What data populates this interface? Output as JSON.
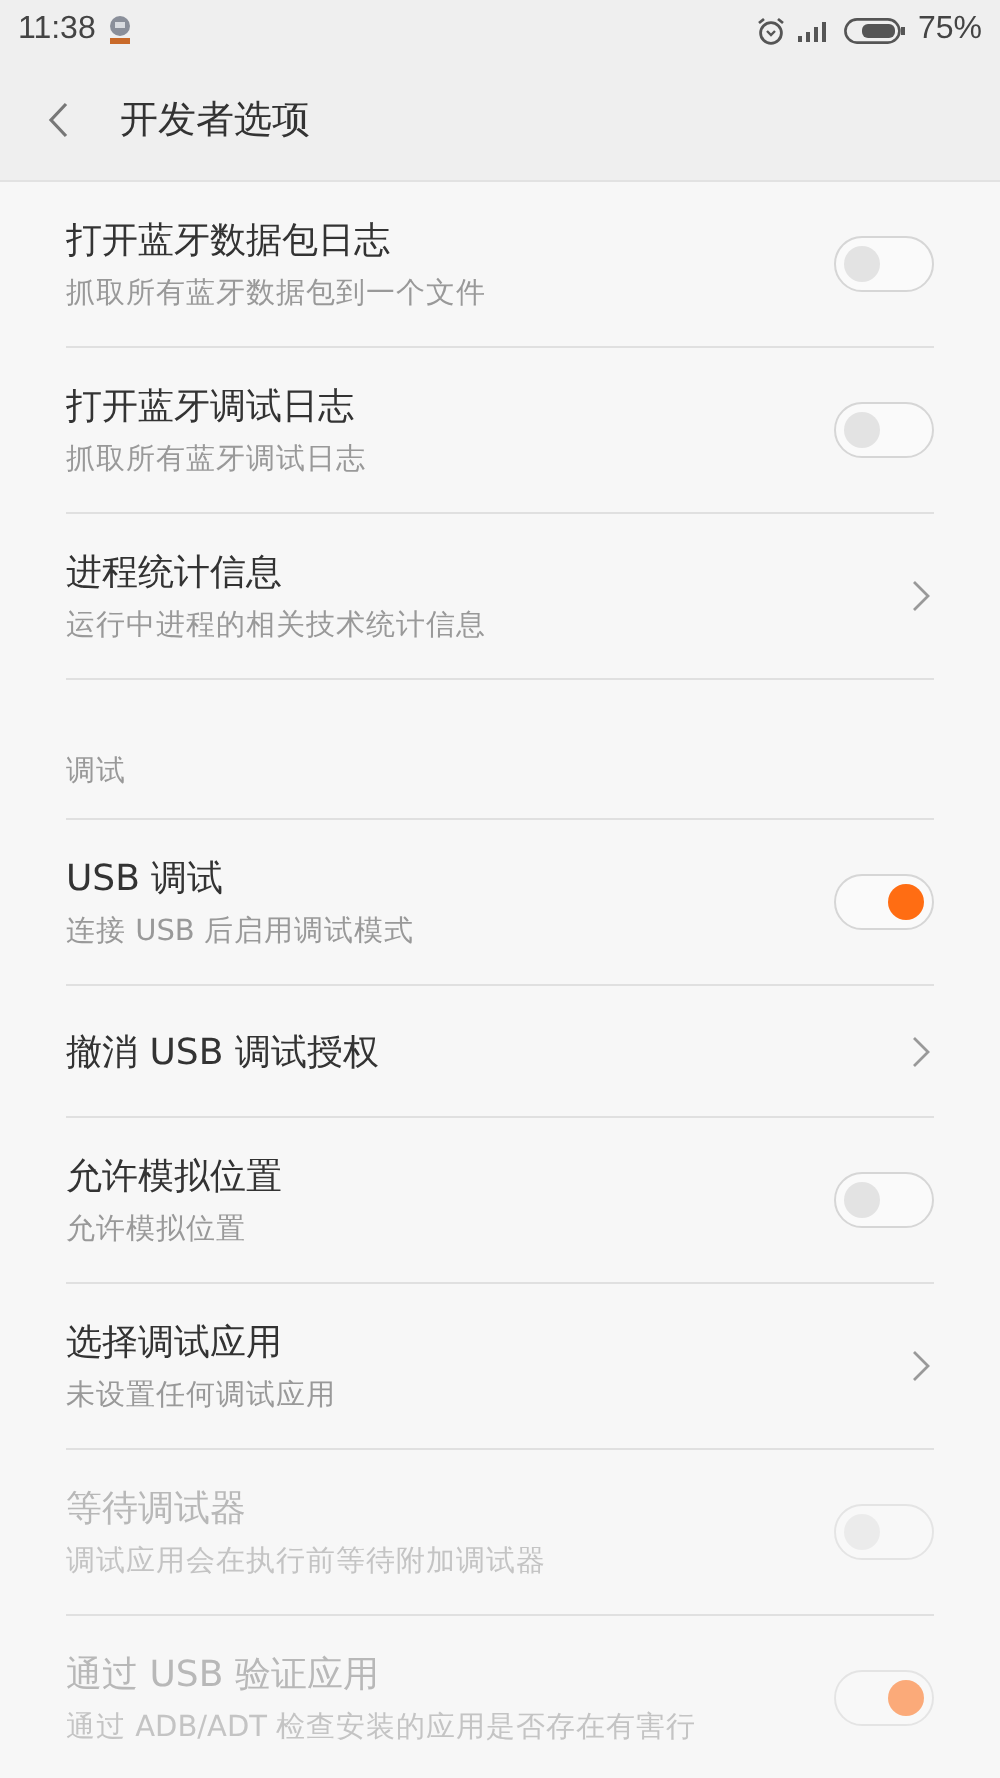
{
  "status_bar": {
    "time": "11:38",
    "battery_percent": "75%"
  },
  "header": {
    "title": "开发者选项"
  },
  "items": [
    {
      "kind": "toggle",
      "title": "打开蓝牙数据包日志",
      "subtitle": "抓取所有蓝牙数据包到一个文件",
      "on": false,
      "disabled": false
    },
    {
      "kind": "toggle",
      "title": "打开蓝牙调试日志",
      "subtitle": "抓取所有蓝牙调试日志",
      "on": false,
      "disabled": false
    },
    {
      "kind": "link",
      "title": "进程统计信息",
      "subtitle": "运行中进程的相关技术统计信息",
      "disabled": false
    },
    {
      "kind": "section",
      "title": "调试"
    },
    {
      "kind": "toggle",
      "title": "USB 调试",
      "subtitle": "连接 USB 后启用调试模式",
      "on": true,
      "disabled": false
    },
    {
      "kind": "link",
      "title": "撤消 USB 调试授权",
      "disabled": false
    },
    {
      "kind": "toggle",
      "title": "允许模拟位置",
      "subtitle": "允许模拟位置",
      "on": false,
      "disabled": false
    },
    {
      "kind": "link",
      "title": "选择调试应用",
      "subtitle": "未设置任何调试应用",
      "disabled": false
    },
    {
      "kind": "toggle",
      "title": "等待调试器",
      "subtitle": "调试应用会在执行前等待附加调试器",
      "on": false,
      "disabled": true
    },
    {
      "kind": "toggle",
      "title": "通过 USB 验证应用",
      "subtitle": "通过 ADB/ADT 检查安装的应用是否存在有害行",
      "on": true,
      "disabled": true
    }
  ]
}
